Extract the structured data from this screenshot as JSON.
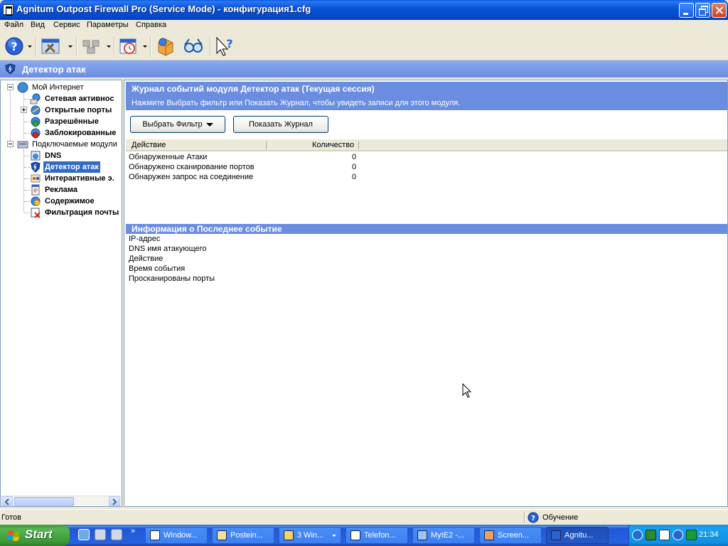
{
  "window": {
    "title": "Agnitum Outpost Firewall Pro (Service Mode) - конфигурация1.cfg"
  },
  "menu": [
    "Файл",
    "Вид",
    "Сервис",
    "Параметры",
    "Справка"
  ],
  "toolbar": {
    "icons": [
      "help-icon",
      "tools-icon",
      "network-icon",
      "timer-icon",
      "package-icon",
      "glasses-icon",
      "context-help-icon"
    ]
  },
  "module_header": {
    "title": "Детектор атак"
  },
  "tree": {
    "root_internet": "Мой Интернет",
    "internet_items": [
      "Сетевая активнос",
      "Открытые порты",
      "Разрешённые",
      "Заблокированные"
    ],
    "root_plugins": "Подключаемые модули",
    "plugin_items": [
      "DNS",
      "Детектор атак",
      "Интерактивные э.",
      "Реклама",
      "Содержимое",
      "Фильтрация почты"
    ],
    "selected": "Детектор атак"
  },
  "log": {
    "title": "Журнал событий модуля Детектор атак (Текущая сессия)",
    "hint": "Нажмите Выбрать фильтр или Показать Журнал, чтобы увидеть записи для этого модуля.",
    "filter_button": "Выбрать Фильтр",
    "show_button": "Показать Журнал",
    "columns": [
      "Действие",
      "Количество"
    ],
    "rows": [
      {
        "action": "Обнаруженные Атаки",
        "count": "0"
      },
      {
        "action": "Обнаружено сканирование портов",
        "count": "0"
      },
      {
        "action": "Обнаружен запрос на соединение",
        "count": "0"
      }
    ]
  },
  "info": {
    "title": "Информация о Последнее событие",
    "fields": [
      "IP-адрес",
      "DNS имя атакующего",
      "Действие",
      "Время события",
      "Просканированы порты"
    ]
  },
  "status": {
    "left": "Готов",
    "mode": "Обучение"
  },
  "taskbar": {
    "start": "Start",
    "quicklaunch_more": "»",
    "tasks": [
      {
        "label": "Window...",
        "active": false
      },
      {
        "label": "Postein...",
        "active": false
      },
      {
        "label": "3 Win...",
        "active": false
      },
      {
        "label": "Telefon...",
        "active": false
      },
      {
        "label": "MyIE2 -...",
        "active": false
      },
      {
        "label": "Screen...",
        "active": false
      },
      {
        "label": "Agnitu...",
        "active": true
      }
    ],
    "clock": "21:34"
  },
  "colors": {
    "accent": "#6a8de0",
    "selection": "#316ac5",
    "titlebar": "#0853d8"
  }
}
